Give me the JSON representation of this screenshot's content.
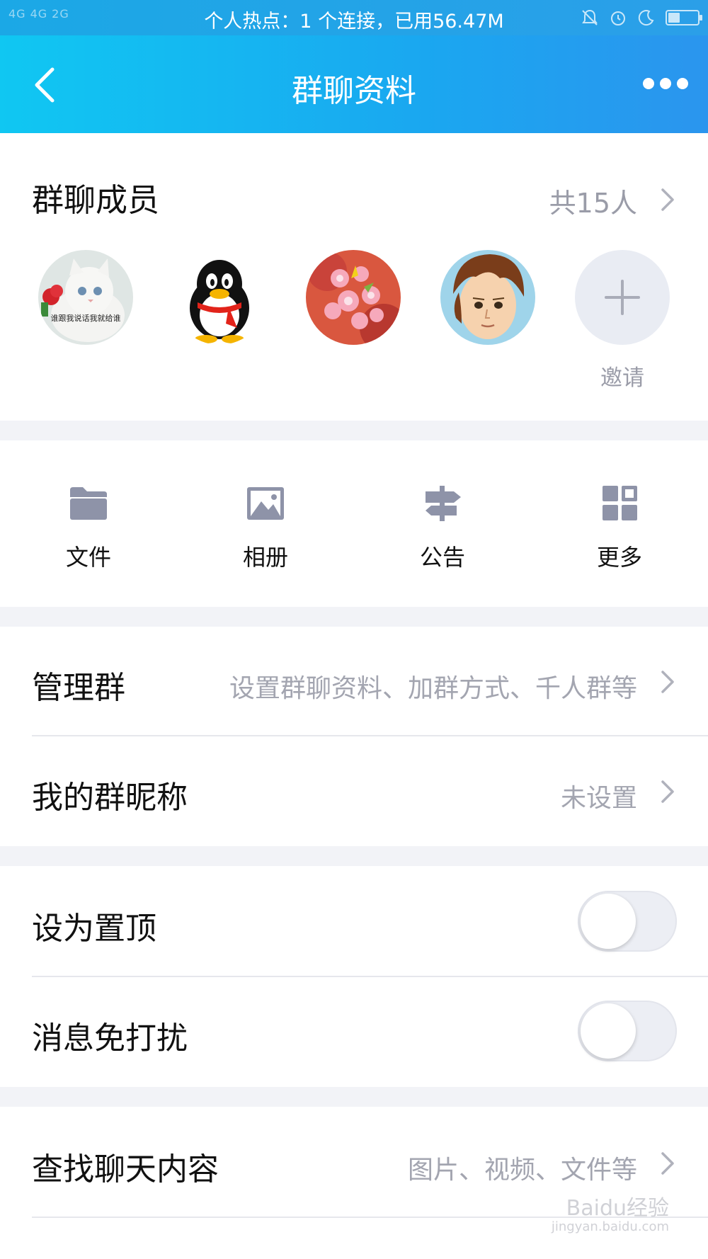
{
  "status_bar": {
    "signal_left": [
      "4G",
      "4G",
      "2G"
    ],
    "hotspot_text": "个人热点：1 个连接，已用56.47M",
    "battery_level": 0.4
  },
  "nav": {
    "title": "群聊资料"
  },
  "members": {
    "title": "群聊成员",
    "count_text": "共15人",
    "avatars": [
      {
        "name": "cat-avatar",
        "caption": "谁跟我说话我就给谁"
      },
      {
        "name": "qq-penguin-avatar"
      },
      {
        "name": "flowers-avatar"
      },
      {
        "name": "cartoon-boy-avatar"
      }
    ],
    "invite_label": "邀请"
  },
  "tools": [
    {
      "label": "文件",
      "icon": "folder-icon"
    },
    {
      "label": "相册",
      "icon": "photo-icon"
    },
    {
      "label": "公告",
      "icon": "signpost-icon"
    },
    {
      "label": "更多",
      "icon": "grid-icon"
    }
  ],
  "rows": {
    "manage": {
      "label": "管理群",
      "value": "设置群聊资料、加群方式、千人群等"
    },
    "nickname": {
      "label": "我的群昵称",
      "value": "未设置"
    },
    "pin": {
      "label": "设为置顶",
      "on": false
    },
    "mute": {
      "label": "消息免打扰",
      "on": false
    },
    "search": {
      "label": "查找聊天内容",
      "value": "图片、视频、文件等"
    }
  },
  "watermark": {
    "brand": "Baidu经验",
    "url": "jingyan.baidu.com"
  },
  "colors": {
    "header_start": "#10c7f2",
    "header_end": "#2b95ee",
    "page_bg": "#f2f3f7",
    "secondary_text": "#9a9ca8"
  }
}
